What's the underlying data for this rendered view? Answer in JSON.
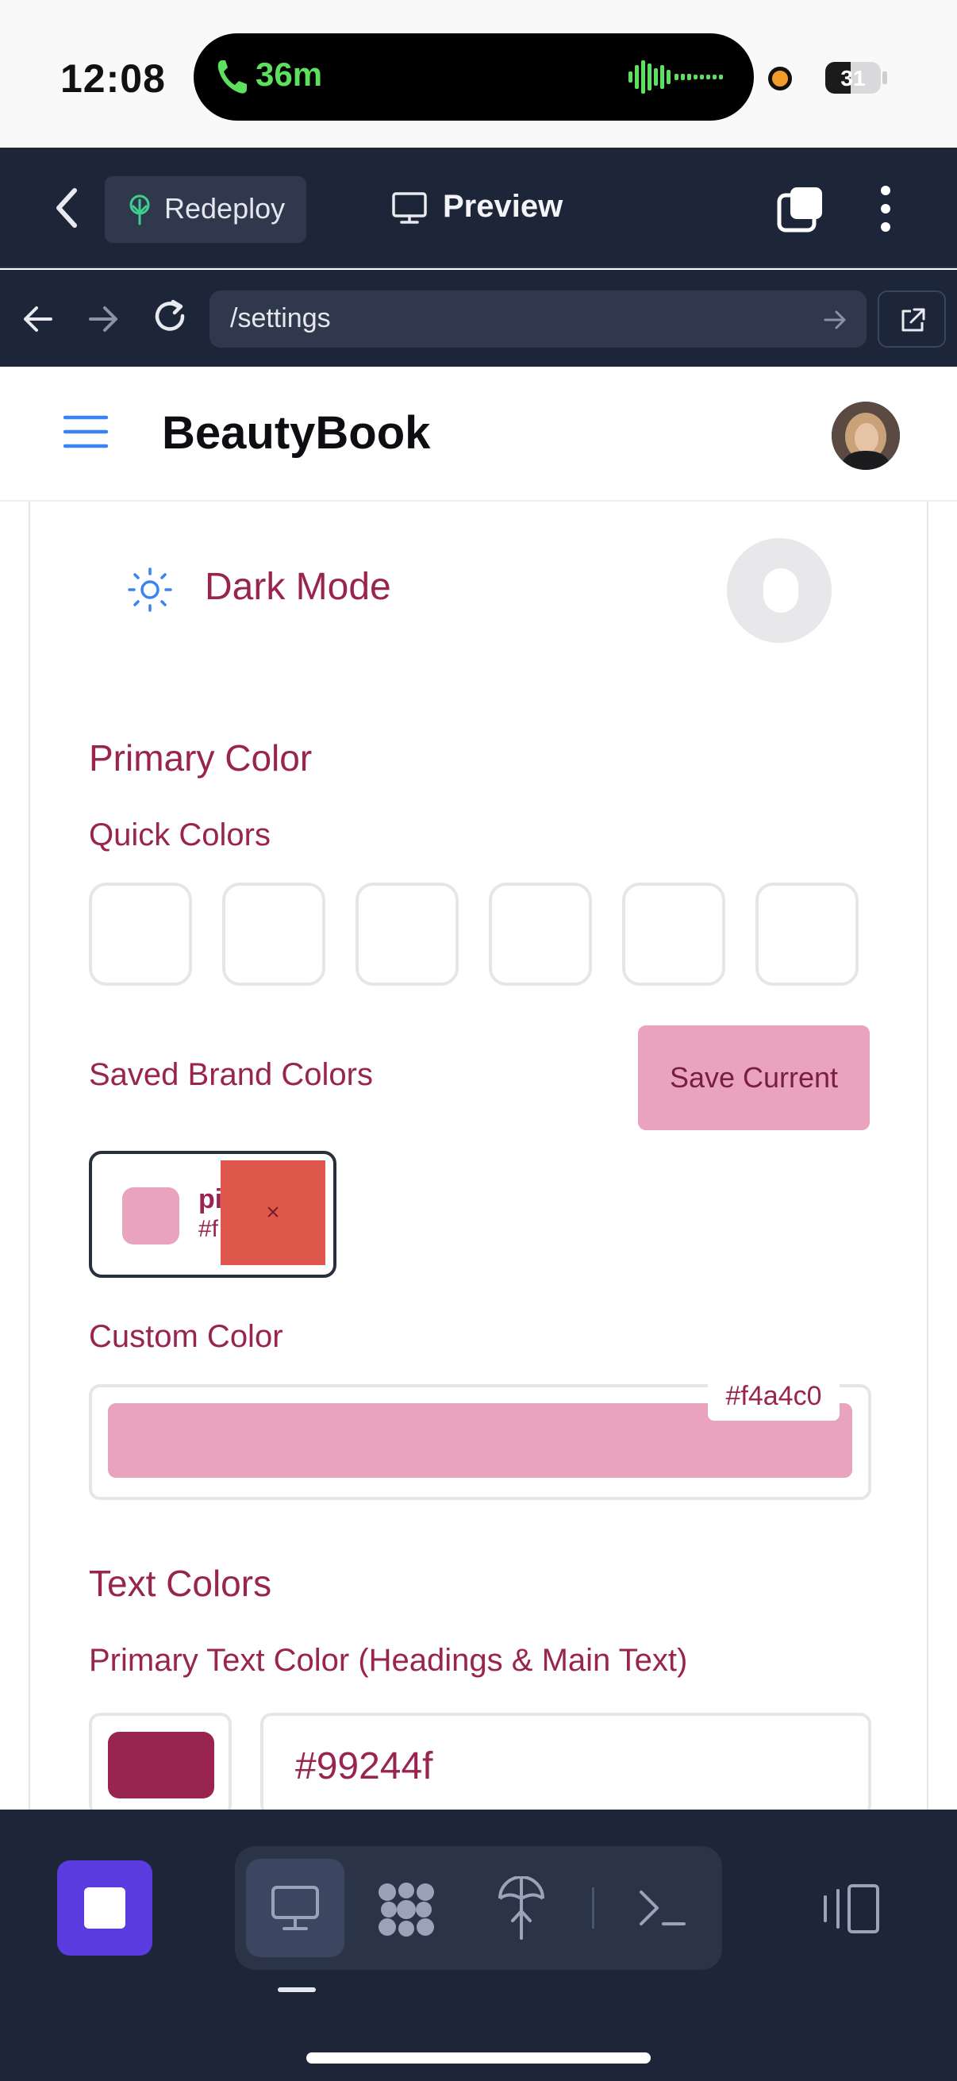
{
  "status_bar": {
    "time": "12:08",
    "call_duration": "36m",
    "battery": "31"
  },
  "app_header": {
    "redeploy_label": "Redeploy",
    "preview_label": "Preview"
  },
  "browser": {
    "url": "/settings"
  },
  "site": {
    "brand": "BeautyBook"
  },
  "settings": {
    "dark_mode_label": "Dark Mode",
    "dark_mode_on": false,
    "primary_color_heading": "Primary Color",
    "quick_colors_label": "Quick Colors",
    "saved_brand_colors_label": "Saved Brand Colors",
    "save_current_label": "Save Current",
    "saved_chip": {
      "name_visible": "pi",
      "hex_visible": "#f",
      "delete_label": "×",
      "color": "#e9a3be"
    },
    "custom_color_label": "Custom Color",
    "custom_color_value": "#f4a4c0",
    "text_colors_heading": "Text Colors",
    "primary_text_color_label": "Primary Text Color (Headings & Main Text)",
    "primary_text_color_value": "#99244f"
  },
  "colors": {
    "accent": "#99244f",
    "pink": "#e9a3be",
    "delete_red": "#e0574c",
    "dark_bg": "#1d2538",
    "stop_purple": "#5b3ce0"
  },
  "bottom_toolbar": {
    "icons": [
      "stop-icon",
      "desktop-icon",
      "grid-icon",
      "deploy-icon",
      "terminal-icon",
      "split-view-icon"
    ]
  }
}
